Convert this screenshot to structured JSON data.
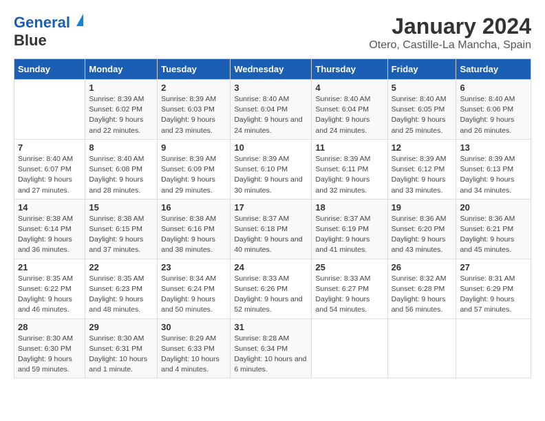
{
  "logo": {
    "line1": "General",
    "line2": "Blue"
  },
  "title": "January 2024",
  "location": "Otero, Castille-La Mancha, Spain",
  "header_color": "#1a5fb4",
  "days_of_week": [
    "Sunday",
    "Monday",
    "Tuesday",
    "Wednesday",
    "Thursday",
    "Friday",
    "Saturday"
  ],
  "weeks": [
    [
      {
        "day": "",
        "sunrise": "",
        "sunset": "",
        "daylight": ""
      },
      {
        "day": "1",
        "sunrise": "Sunrise: 8:39 AM",
        "sunset": "Sunset: 6:02 PM",
        "daylight": "Daylight: 9 hours and 22 minutes."
      },
      {
        "day": "2",
        "sunrise": "Sunrise: 8:39 AM",
        "sunset": "Sunset: 6:03 PM",
        "daylight": "Daylight: 9 hours and 23 minutes."
      },
      {
        "day": "3",
        "sunrise": "Sunrise: 8:40 AM",
        "sunset": "Sunset: 6:04 PM",
        "daylight": "Daylight: 9 hours and 24 minutes."
      },
      {
        "day": "4",
        "sunrise": "Sunrise: 8:40 AM",
        "sunset": "Sunset: 6:04 PM",
        "daylight": "Daylight: 9 hours and 24 minutes."
      },
      {
        "day": "5",
        "sunrise": "Sunrise: 8:40 AM",
        "sunset": "Sunset: 6:05 PM",
        "daylight": "Daylight: 9 hours and 25 minutes."
      },
      {
        "day": "6",
        "sunrise": "Sunrise: 8:40 AM",
        "sunset": "Sunset: 6:06 PM",
        "daylight": "Daylight: 9 hours and 26 minutes."
      }
    ],
    [
      {
        "day": "7",
        "sunrise": "Sunrise: 8:40 AM",
        "sunset": "Sunset: 6:07 PM",
        "daylight": "Daylight: 9 hours and 27 minutes."
      },
      {
        "day": "8",
        "sunrise": "Sunrise: 8:40 AM",
        "sunset": "Sunset: 6:08 PM",
        "daylight": "Daylight: 9 hours and 28 minutes."
      },
      {
        "day": "9",
        "sunrise": "Sunrise: 8:39 AM",
        "sunset": "Sunset: 6:09 PM",
        "daylight": "Daylight: 9 hours and 29 minutes."
      },
      {
        "day": "10",
        "sunrise": "Sunrise: 8:39 AM",
        "sunset": "Sunset: 6:10 PM",
        "daylight": "Daylight: 9 hours and 30 minutes."
      },
      {
        "day": "11",
        "sunrise": "Sunrise: 8:39 AM",
        "sunset": "Sunset: 6:11 PM",
        "daylight": "Daylight: 9 hours and 32 minutes."
      },
      {
        "day": "12",
        "sunrise": "Sunrise: 8:39 AM",
        "sunset": "Sunset: 6:12 PM",
        "daylight": "Daylight: 9 hours and 33 minutes."
      },
      {
        "day": "13",
        "sunrise": "Sunrise: 8:39 AM",
        "sunset": "Sunset: 6:13 PM",
        "daylight": "Daylight: 9 hours and 34 minutes."
      }
    ],
    [
      {
        "day": "14",
        "sunrise": "Sunrise: 8:38 AM",
        "sunset": "Sunset: 6:14 PM",
        "daylight": "Daylight: 9 hours and 36 minutes."
      },
      {
        "day": "15",
        "sunrise": "Sunrise: 8:38 AM",
        "sunset": "Sunset: 6:15 PM",
        "daylight": "Daylight: 9 hours and 37 minutes."
      },
      {
        "day": "16",
        "sunrise": "Sunrise: 8:38 AM",
        "sunset": "Sunset: 6:16 PM",
        "daylight": "Daylight: 9 hours and 38 minutes."
      },
      {
        "day": "17",
        "sunrise": "Sunrise: 8:37 AM",
        "sunset": "Sunset: 6:18 PM",
        "daylight": "Daylight: 9 hours and 40 minutes."
      },
      {
        "day": "18",
        "sunrise": "Sunrise: 8:37 AM",
        "sunset": "Sunset: 6:19 PM",
        "daylight": "Daylight: 9 hours and 41 minutes."
      },
      {
        "day": "19",
        "sunrise": "Sunrise: 8:36 AM",
        "sunset": "Sunset: 6:20 PM",
        "daylight": "Daylight: 9 hours and 43 minutes."
      },
      {
        "day": "20",
        "sunrise": "Sunrise: 8:36 AM",
        "sunset": "Sunset: 6:21 PM",
        "daylight": "Daylight: 9 hours and 45 minutes."
      }
    ],
    [
      {
        "day": "21",
        "sunrise": "Sunrise: 8:35 AM",
        "sunset": "Sunset: 6:22 PM",
        "daylight": "Daylight: 9 hours and 46 minutes."
      },
      {
        "day": "22",
        "sunrise": "Sunrise: 8:35 AM",
        "sunset": "Sunset: 6:23 PM",
        "daylight": "Daylight: 9 hours and 48 minutes."
      },
      {
        "day": "23",
        "sunrise": "Sunrise: 8:34 AM",
        "sunset": "Sunset: 6:24 PM",
        "daylight": "Daylight: 9 hours and 50 minutes."
      },
      {
        "day": "24",
        "sunrise": "Sunrise: 8:33 AM",
        "sunset": "Sunset: 6:26 PM",
        "daylight": "Daylight: 9 hours and 52 minutes."
      },
      {
        "day": "25",
        "sunrise": "Sunrise: 8:33 AM",
        "sunset": "Sunset: 6:27 PM",
        "daylight": "Daylight: 9 hours and 54 minutes."
      },
      {
        "day": "26",
        "sunrise": "Sunrise: 8:32 AM",
        "sunset": "Sunset: 6:28 PM",
        "daylight": "Daylight: 9 hours and 56 minutes."
      },
      {
        "day": "27",
        "sunrise": "Sunrise: 8:31 AM",
        "sunset": "Sunset: 6:29 PM",
        "daylight": "Daylight: 9 hours and 57 minutes."
      }
    ],
    [
      {
        "day": "28",
        "sunrise": "Sunrise: 8:30 AM",
        "sunset": "Sunset: 6:30 PM",
        "daylight": "Daylight: 9 hours and 59 minutes."
      },
      {
        "day": "29",
        "sunrise": "Sunrise: 8:30 AM",
        "sunset": "Sunset: 6:31 PM",
        "daylight": "Daylight: 10 hours and 1 minute."
      },
      {
        "day": "30",
        "sunrise": "Sunrise: 8:29 AM",
        "sunset": "Sunset: 6:33 PM",
        "daylight": "Daylight: 10 hours and 4 minutes."
      },
      {
        "day": "31",
        "sunrise": "Sunrise: 8:28 AM",
        "sunset": "Sunset: 6:34 PM",
        "daylight": "Daylight: 10 hours and 6 minutes."
      },
      {
        "day": "",
        "sunrise": "",
        "sunset": "",
        "daylight": ""
      },
      {
        "day": "",
        "sunrise": "",
        "sunset": "",
        "daylight": ""
      },
      {
        "day": "",
        "sunrise": "",
        "sunset": "",
        "daylight": ""
      }
    ]
  ]
}
